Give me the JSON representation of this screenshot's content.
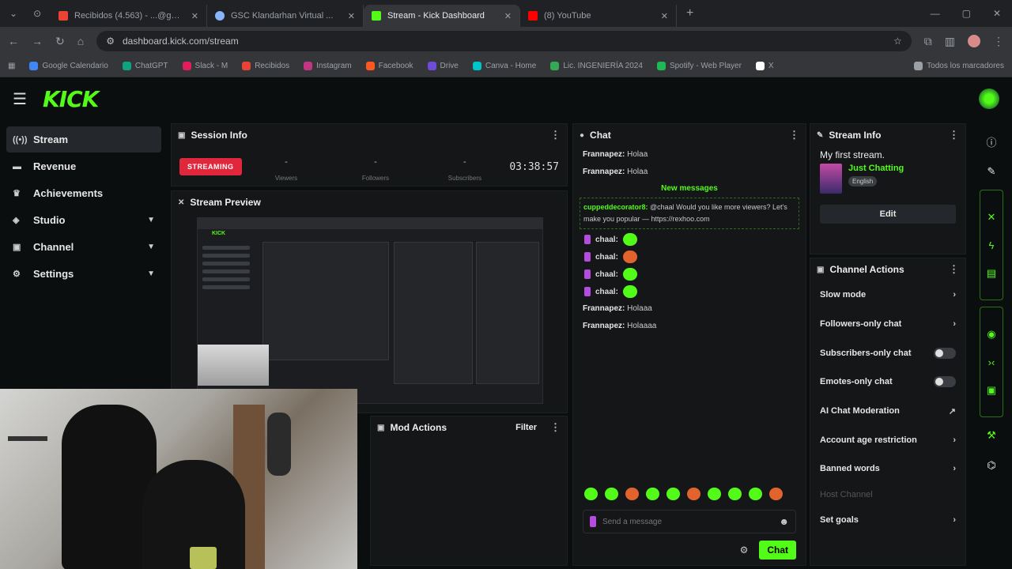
{
  "browser": {
    "tabs": [
      {
        "title": "Recibidos (4.563) - ...@gmail...",
        "color": "#ea4335"
      },
      {
        "title": "GSC Klandarhan Virtual ...",
        "color": "#8ab4f8"
      },
      {
        "title": "Stream - Kick Dashboard",
        "color": "#53fc18"
      },
      {
        "title": "(8) YouTube",
        "color": "#ff0000"
      }
    ],
    "url": "dashboard.kick.com/stream",
    "bookmarks": [
      {
        "label": "Google Calendario",
        "color": "#4285f4"
      },
      {
        "label": "ChatGPT",
        "color": "#10a37f"
      },
      {
        "label": "Slack - M",
        "color": "#e01e5a"
      },
      {
        "label": "Recibidos",
        "color": "#ea4335"
      },
      {
        "label": "Instagram",
        "color": "#c13584"
      },
      {
        "label": "Facebook",
        "color": "#ff5722"
      },
      {
        "label": "Drive",
        "color": "#6e4bd8"
      },
      {
        "label": "Canva - Home",
        "color": "#00c4cc"
      },
      {
        "label": "Lic. INGENIERÍA 2024",
        "color": "#34a853"
      },
      {
        "label": "Spotify - Web Player",
        "color": "#1db954"
      },
      {
        "label": "X",
        "color": "#ffffff"
      },
      {
        "label": "Todos los marcadores",
        "color": "#9aa0a6"
      }
    ]
  },
  "sidebar": {
    "items": [
      {
        "label": "Stream",
        "icon": "broadcast-icon",
        "chev": ""
      },
      {
        "label": "Revenue",
        "icon": "revenue-icon",
        "chev": ""
      },
      {
        "label": "Achievements",
        "icon": "trophy-icon",
        "chev": ""
      },
      {
        "label": "Studio",
        "icon": "studio-icon",
        "chev": "▼"
      },
      {
        "label": "Channel",
        "icon": "channel-icon",
        "chev": "▼"
      },
      {
        "label": "Settings",
        "icon": "gear-icon",
        "chev": "▼"
      }
    ]
  },
  "session": {
    "title": "Session Info",
    "status": "STREAMING",
    "stats": [
      {
        "value": "-",
        "key": "Viewers"
      },
      {
        "value": "-",
        "key": "Followers"
      },
      {
        "value": "-",
        "key": "Subscribers"
      }
    ],
    "duration": "03:38:57"
  },
  "preview": {
    "title": "Stream Preview",
    "mini_logo": "KICK"
  },
  "mod": {
    "title": "Mod Actions",
    "filter": "Filter"
  },
  "chat": {
    "title": "Chat",
    "messages_top": [
      {
        "user": "Frannapez:",
        "text": " Holaa"
      },
      {
        "user": "Frannapez:",
        "text": " Holaa"
      }
    ],
    "new_label": "New messages",
    "highlight": {
      "user": "cuppeddecorator8:",
      "text": " @chaal Would you like more viewers? Let's make you popular — https://rexhoo.com"
    },
    "emote_users": [
      "chaal:",
      "chaal:",
      "chaal:",
      "chaal:"
    ],
    "messages_bottom": [
      {
        "user": "Frannapez:",
        "text": " Holaaa"
      },
      {
        "user": "Frannapez:",
        "text": " Holaaaa"
      }
    ],
    "placeholder": "Send a message",
    "send": "Chat"
  },
  "stream_info": {
    "title": "Stream Info",
    "stream_title": "My first stream.",
    "category": "Just Chatting",
    "tag": "English",
    "edit": "Edit"
  },
  "channel_actions": {
    "title": "Channel Actions",
    "items": [
      {
        "label": "Slow mode",
        "type": "arrow"
      },
      {
        "label": "Followers-only chat",
        "type": "arrow"
      },
      {
        "label": "Subscribers-only chat",
        "type": "toggle"
      },
      {
        "label": "Emotes-only chat",
        "type": "toggle"
      },
      {
        "label": "AI Chat Moderation",
        "type": "link"
      },
      {
        "label": "Account age restriction",
        "type": "arrow"
      },
      {
        "label": "Banned words",
        "type": "arrow"
      }
    ],
    "host": "Host Channel",
    "set_goals": "Set goals"
  }
}
